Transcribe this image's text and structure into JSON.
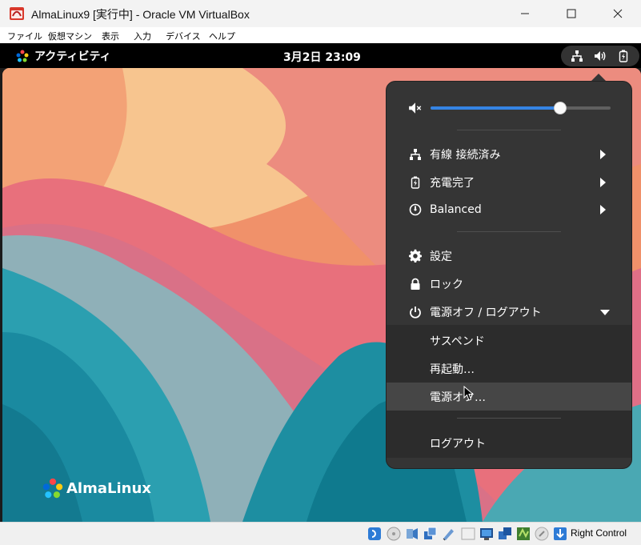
{
  "window": {
    "title": "AlmaLinux9 [実行中] - Oracle VM VirtualBox",
    "controls": [
      "minimize-icon",
      "maximize-icon",
      "close-icon"
    ]
  },
  "menubar": {
    "items": [
      "ファイル",
      "仮想マシン",
      "表示",
      "入力",
      "デバイス",
      "ヘルプ"
    ]
  },
  "topbar": {
    "activities_label": "アクティビティ",
    "clock": "3月2日  23:09",
    "tray_icons": [
      "network-wired-icon",
      "speaker-icon",
      "battery-charged-icon"
    ]
  },
  "desktop": {
    "brand_text": "AlmaLinux"
  },
  "system_menu": {
    "volume": {
      "icon": "speaker-muted-icon",
      "level_fraction": 0.72
    },
    "items": [
      {
        "label": "有線 接続済み",
        "icon": "network-wired-icon",
        "has_submenu": true
      },
      {
        "label": "充電完了",
        "icon": "battery-charged-icon",
        "has_submenu": true
      },
      {
        "label": "Balanced",
        "icon": "power-profile-icon",
        "has_submenu": true
      },
      {
        "label": "設定",
        "icon": "gear-icon",
        "has_submenu": false
      },
      {
        "label": "ロック",
        "icon": "lock-icon",
        "has_submenu": false
      },
      {
        "label": "電源オフ / ログアウト",
        "icon": "power-icon",
        "expanded": true
      }
    ],
    "power_submenu": [
      {
        "label": "サスペンド"
      },
      {
        "label": "再起動…"
      },
      {
        "label": "電源オフ…",
        "hovered": true
      },
      {
        "label": "ログアウト"
      }
    ]
  },
  "statusbar": {
    "host_key": "Right Control",
    "icons": [
      "audio-icon",
      "optical-drive-icon",
      "usb-icon",
      "network-icon",
      "shared-folders-icon",
      "display-icon",
      "video-capture-icon",
      "cpu-icon",
      "mouse-integration-icon",
      "host-key-icon"
    ]
  },
  "colors": {
    "accent": "#3584e4",
    "panel_bg": "#353535",
    "submenu_bg": "#2c2c2c",
    "hover_bg": "#464646"
  }
}
